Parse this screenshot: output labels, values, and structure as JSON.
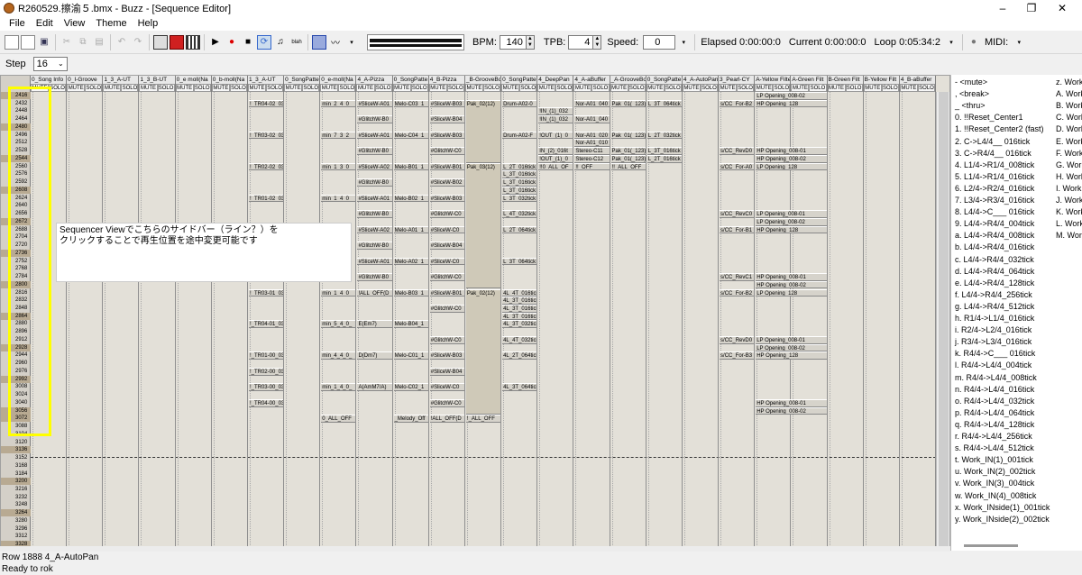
{
  "window": {
    "title": "R260529.擦渝５.bmx - Buzz - [Sequence Editor]"
  },
  "menu": [
    "File",
    "Edit",
    "View",
    "Theme",
    "Help"
  ],
  "toolbar": {
    "bpm_label": "BPM:",
    "bpm": "140",
    "tpb_label": "TPB:",
    "tpb": "4",
    "speed_label": "Speed:",
    "speed": "0",
    "elapsed": "Elapsed 0:00:00:0",
    "current": "Current 0:00:00:0",
    "loop": "Loop 0:05:34:2",
    "midi_label": "MIDI:"
  },
  "step": {
    "label": "Step",
    "value": "16"
  },
  "columns": [
    "0_Song Info",
    "0_I-Groove",
    "1_3_A-UT",
    "1_3_B-UT",
    "0_e moll(Na",
    "0_b-moll(Na",
    "1_3_A-UT",
    "0_SongPatte",
    "0_e-moll(Na",
    "4_A-Pizza",
    "0_SongPatte",
    "4_B-Pizza",
    "_B-GrooveBo",
    "0_SongPatte",
    "4_DeepPan",
    "4_A-aBuffer",
    "_A-GrooveBo",
    "0_SongPatte",
    "4_A-AutoPan",
    "3_Pearl-CY",
    "A-Yellow Filte",
    "A-Green Filt",
    "B-Green Filt",
    "B-Yellow Filt",
    "4_B-aBuffer"
  ],
  "mute_label": "MUTE",
  "solo_label": "SOLO",
  "rows": [
    "2416",
    "2432",
    "2448",
    "2464",
    "2480",
    "2496",
    "2512",
    "2528",
    "2544",
    "2560",
    "2576",
    "2592",
    "2608",
    "2624",
    "2640",
    "2656",
    "2672",
    "2688",
    "2704",
    "2720",
    "2736",
    "2752",
    "2768",
    "2784",
    "2800",
    "2816",
    "2832",
    "2848",
    "2864",
    "2880",
    "2896",
    "2912",
    "2928",
    "2944",
    "2960",
    "2976",
    "2992",
    "3008",
    "3024",
    "3040",
    "3056",
    "3072",
    "3088",
    "3104",
    "3120",
    "3136",
    "3152",
    "3168",
    "3184",
    "3200",
    "3216",
    "3232",
    "3248",
    "3264",
    "3280",
    "3296",
    "3312",
    "3328"
  ],
  "patterns": [
    {
      "col": 6,
      "row": 1,
      "len": 1,
      "text": "!_TR04-02_032"
    },
    {
      "col": 6,
      "row": 5,
      "len": 1,
      "text": "!_TR03-02_032"
    },
    {
      "col": 6,
      "row": 9,
      "len": 1,
      "text": "!_TR02-02_032"
    },
    {
      "col": 6,
      "row": 13,
      "len": 1,
      "text": "!_TR01-02_032"
    },
    {
      "col": 6,
      "row": 25,
      "len": 1,
      "text": "!_TR03-01_032"
    },
    {
      "col": 6,
      "row": 29,
      "len": 1,
      "text": "!_TR04-01_032"
    },
    {
      "col": 6,
      "row": 33,
      "len": 1,
      "text": "!_TR01-00_032"
    },
    {
      "col": 6,
      "row": 35,
      "len": 1,
      "text": "!_TR02-00_032"
    },
    {
      "col": 6,
      "row": 37,
      "len": 1,
      "text": "!_TR03-00_032"
    },
    {
      "col": 6,
      "row": 39,
      "len": 1,
      "text": "!_TR04-00_032"
    },
    {
      "col": 8,
      "row": 1,
      "len": 1,
      "text": "min_2_4_0_"
    },
    {
      "col": 8,
      "row": 5,
      "len": 1,
      "text": "min_7_3_2_"
    },
    {
      "col": 8,
      "row": 9,
      "len": 1,
      "text": "min_1_3_0_"
    },
    {
      "col": 8,
      "row": 13,
      "len": 1,
      "text": "min_1_4_0_"
    },
    {
      "col": 8,
      "row": 25,
      "len": 1,
      "text": "min_1_4_0_"
    },
    {
      "col": 8,
      "row": 29,
      "len": 1,
      "text": "min_5_4_0_"
    },
    {
      "col": 8,
      "row": 33,
      "len": 1,
      "text": "min_4_4_0_"
    },
    {
      "col": 8,
      "row": 37,
      "len": 1,
      "text": "min_1_4_0_"
    },
    {
      "col": 8,
      "row": 41,
      "len": 1,
      "text": "0_ALL_OFF"
    },
    {
      "col": 9,
      "row": 1,
      "len": 1,
      "text": "#SliceW-A01"
    },
    {
      "col": 9,
      "row": 3,
      "len": 1,
      "text": "#GlitchW-B0"
    },
    {
      "col": 9,
      "row": 5,
      "len": 1,
      "text": "#SliceW-A01"
    },
    {
      "col": 9,
      "row": 7,
      "len": 1,
      "text": "#GlitchW-B0"
    },
    {
      "col": 9,
      "row": 9,
      "len": 1,
      "text": "#SliceW-A02"
    },
    {
      "col": 9,
      "row": 11,
      "len": 1,
      "text": "#GlitchW-B0"
    },
    {
      "col": 9,
      "row": 13,
      "len": 1,
      "text": "#SliceW-A01"
    },
    {
      "col": 9,
      "row": 15,
      "len": 1,
      "text": "#GlitchW-B0"
    },
    {
      "col": 9,
      "row": 17,
      "len": 1,
      "text": "#SliceW-A02"
    },
    {
      "col": 9,
      "row": 19,
      "len": 1,
      "text": "#GlitchW-B0"
    },
    {
      "col": 9,
      "row": 21,
      "len": 1,
      "text": "#SliceW-A01"
    },
    {
      "col": 9,
      "row": 23,
      "len": 1,
      "text": "#GlitchW-B0"
    },
    {
      "col": 9,
      "row": 25,
      "len": 1,
      "text": "!ALL_OFF(D"
    },
    {
      "col": 9,
      "row": 29,
      "len": 1,
      "text": "E(Em7)"
    },
    {
      "col": 9,
      "row": 33,
      "len": 1,
      "text": "D(Dm7)"
    },
    {
      "col": 9,
      "row": 37,
      "len": 1,
      "text": "A(AmM7/A)"
    },
    {
      "col": 10,
      "row": 1,
      "len": 1,
      "text": "Melo-C03_1"
    },
    {
      "col": 10,
      "row": 5,
      "len": 1,
      "text": "Melo-C04_1"
    },
    {
      "col": 10,
      "row": 9,
      "len": 1,
      "text": "Melo-B01_1"
    },
    {
      "col": 10,
      "row": 13,
      "len": 1,
      "text": "Melo-B02_1"
    },
    {
      "col": 10,
      "row": 17,
      "len": 1,
      "text": "Melo-A01_1"
    },
    {
      "col": 10,
      "row": 21,
      "len": 1,
      "text": "Melo-A02_1"
    },
    {
      "col": 10,
      "row": 25,
      "len": 1,
      "text": "Melo-B03_1"
    },
    {
      "col": 10,
      "row": 29,
      "len": 1,
      "text": "Melo-B04_1"
    },
    {
      "col": 10,
      "row": 33,
      "len": 1,
      "text": "Melo-C01_1"
    },
    {
      "col": 10,
      "row": 37,
      "len": 1,
      "text": "Melo-C02_1"
    },
    {
      "col": 10,
      "row": 41,
      "len": 1,
      "text": "_Melody_Off"
    },
    {
      "col": 11,
      "row": 1,
      "len": 1,
      "text": "#SliceW-B03"
    },
    {
      "col": 11,
      "row": 3,
      "len": 1,
      "text": "#SliceW-B04"
    },
    {
      "col": 11,
      "row": 5,
      "len": 1,
      "text": "#SliceW-B03"
    },
    {
      "col": 11,
      "row": 7,
      "len": 1,
      "text": "#GlitchW-C0"
    },
    {
      "col": 11,
      "row": 9,
      "len": 1,
      "text": "#SliceW-B01"
    },
    {
      "col": 11,
      "row": 11,
      "len": 1,
      "text": "#SliceW-B02"
    },
    {
      "col": 11,
      "row": 13,
      "len": 1,
      "text": "#SliceW-B03"
    },
    {
      "col": 11,
      "row": 15,
      "len": 1,
      "text": "#GlitchW-C0"
    },
    {
      "col": 11,
      "row": 17,
      "len": 1,
      "text": "#SliceW-C0"
    },
    {
      "col": 11,
      "row": 19,
      "len": 1,
      "text": "#SliceW-B04"
    },
    {
      "col": 11,
      "row": 21,
      "len": 1,
      "text": "#SliceW-C0"
    },
    {
      "col": 11,
      "row": 23,
      "len": 1,
      "text": "#GlitchW-C0"
    },
    {
      "col": 11,
      "row": 25,
      "len": 1,
      "text": "#SliceW-B01"
    },
    {
      "col": 11,
      "row": 27,
      "len": 1,
      "text": "#GlitchW-C0"
    },
    {
      "col": 11,
      "row": 31,
      "len": 1,
      "text": "#GlitchW-C0"
    },
    {
      "col": 11,
      "row": 33,
      "len": 1,
      "text": "#SliceW-B03"
    },
    {
      "col": 11,
      "row": 35,
      "len": 1,
      "text": "#SliceW-B04"
    },
    {
      "col": 11,
      "row": 37,
      "len": 1,
      "text": "#SliceW-C0"
    },
    {
      "col": 11,
      "row": 39,
      "len": 1,
      "text": "#GlitchW-C0"
    },
    {
      "col": 11,
      "row": 41,
      "len": 1,
      "text": "!ALL_OFF(D"
    },
    {
      "col": 12,
      "row": 1,
      "len": 8,
      "text": "Pak_02(12)"
    },
    {
      "col": 12,
      "row": 9,
      "len": 16,
      "text": "Pak_03(12)"
    },
    {
      "col": 12,
      "row": 25,
      "len": 16,
      "text": "Pak_02(12)"
    },
    {
      "col": 12,
      "row": 41,
      "len": 1,
      "text": "!_ALL_OFF"
    },
    {
      "col": 13,
      "row": 1,
      "len": 1,
      "text": "Drum-A02-0"
    },
    {
      "col": 13,
      "row": 5,
      "len": 1,
      "text": "Drum-A02-F"
    },
    {
      "col": 13,
      "row": 9,
      "len": 1,
      "text": "L_2T_016tick"
    },
    {
      "col": 13,
      "row": 10,
      "len": 1,
      "text": "L_3T_016tick"
    },
    {
      "col": 13,
      "row": 11,
      "len": 1,
      "text": "L_3T_016tick"
    },
    {
      "col": 13,
      "row": 12,
      "len": 1,
      "text": "L_3T_016tick"
    },
    {
      "col": 13,
      "row": 13,
      "len": 1,
      "text": "L_3T_032tick"
    },
    {
      "col": 13,
      "row": 15,
      "len": 1,
      "text": "L_4T_032tick"
    },
    {
      "col": 13,
      "row": 17,
      "len": 1,
      "text": "L_2T_064tick"
    },
    {
      "col": 13,
      "row": 21,
      "len": 1,
      "text": "L_3T_064tick"
    },
    {
      "col": 13,
      "row": 25,
      "len": 1,
      "text": "4L_4T_016tick"
    },
    {
      "col": 13,
      "row": 26,
      "len": 1,
      "text": "4L_3T_016tick"
    },
    {
      "col": 13,
      "row": 27,
      "len": 1,
      "text": "4L_3T_016tick"
    },
    {
      "col": 13,
      "row": 28,
      "len": 1,
      "text": "4L_3T_016tick"
    },
    {
      "col": 13,
      "row": 29,
      "len": 1,
      "text": "4L_3T_032tick"
    },
    {
      "col": 13,
      "row": 31,
      "len": 1,
      "text": "4L_4T_032tick"
    },
    {
      "col": 13,
      "row": 33,
      "len": 1,
      "text": "4L_2T_064tick"
    },
    {
      "col": 13,
      "row": 37,
      "len": 1,
      "text": "4L_3T_064tick"
    },
    {
      "col": 14,
      "row": 2,
      "len": 1,
      "text": "!IN_(1)_032"
    },
    {
      "col": 14,
      "row": 3,
      "len": 1,
      "text": "!IN_(1)_032"
    },
    {
      "col": 14,
      "row": 5,
      "len": 1,
      "text": "!OUT_(1)_0"
    },
    {
      "col": 14,
      "row": 7,
      "len": 1,
      "text": "IN_(2)_016t"
    },
    {
      "col": 14,
      "row": 8,
      "len": 1,
      "text": "!OUT_(1)_0"
    },
    {
      "col": 14,
      "row": 9,
      "len": 1,
      "text": "!!0_ALL_OF"
    },
    {
      "col": 15,
      "row": 1,
      "len": 1,
      "text": "Nor-A01_040"
    },
    {
      "col": 15,
      "row": 3,
      "len": 1,
      "text": "Nor-A01_040"
    },
    {
      "col": 15,
      "row": 5,
      "len": 1,
      "text": "Nor-A01_020"
    },
    {
      "col": 15,
      "row": 6,
      "len": 1,
      "text": "Nor-A01_010"
    },
    {
      "col": 15,
      "row": 7,
      "len": 1,
      "text": "Stereo-C11"
    },
    {
      "col": 15,
      "row": 8,
      "len": 1,
      "text": "Stereo-C12"
    },
    {
      "col": 15,
      "row": 9,
      "len": 1,
      "text": "!!_OFF"
    },
    {
      "col": 16,
      "row": 1,
      "len": 1,
      "text": "Pak_01(_123)"
    },
    {
      "col": 16,
      "row": 5,
      "len": 1,
      "text": "Pak_01(_123)"
    },
    {
      "col": 16,
      "row": 7,
      "len": 1,
      "text": "Pak_01(_123)"
    },
    {
      "col": 16,
      "row": 8,
      "len": 1,
      "text": "Pak_01(_123)"
    },
    {
      "col": 16,
      "row": 9,
      "len": 1,
      "text": "!!_ALL_OFF"
    },
    {
      "col": 17,
      "row": 1,
      "len": 1,
      "text": "L_3T_064tick"
    },
    {
      "col": 17,
      "row": 5,
      "len": 1,
      "text": "L_2T_032tick"
    },
    {
      "col": 17,
      "row": 7,
      "len": 1,
      "text": "L_3T_016tick"
    },
    {
      "col": 17,
      "row": 8,
      "len": 1,
      "text": "L_2T_016tick"
    },
    {
      "col": 19,
      "row": 1,
      "len": 1,
      "text": "s/CC_For-B2"
    },
    {
      "col": 19,
      "row": 7,
      "len": 1,
      "text": "s/CC_RevD0"
    },
    {
      "col": 19,
      "row": 9,
      "len": 1,
      "text": "s/CC_For-A0"
    },
    {
      "col": 19,
      "row": 15,
      "len": 1,
      "text": "s/CC_RevC0"
    },
    {
      "col": 19,
      "row": 17,
      "len": 1,
      "text": "s/CC_For-B1"
    },
    {
      "col": 19,
      "row": 23,
      "len": 1,
      "text": "s/CC_RevC1"
    },
    {
      "col": 19,
      "row": 25,
      "len": 1,
      "text": "s/CC_For-B2"
    },
    {
      "col": 19,
      "row": 31,
      "len": 1,
      "text": "s/CC_RevD0"
    },
    {
      "col": 19,
      "row": 33,
      "len": 1,
      "text": "s/CC_For-B3"
    },
    {
      "col": 20,
      "row": 0,
      "len": 1,
      "text": "LP Opening_008-02"
    },
    {
      "col": 20,
      "row": 1,
      "len": 1,
      "text": "HP Opening_128"
    },
    {
      "col": 20,
      "row": 7,
      "len": 1,
      "text": "HP Opening_008-01"
    },
    {
      "col": 20,
      "row": 8,
      "len": 1,
      "text": "HP Opening_008-02"
    },
    {
      "col": 20,
      "row": 9,
      "len": 1,
      "text": "LP Opening_128"
    },
    {
      "col": 20,
      "row": 15,
      "len": 1,
      "text": "LP Opening_008-01"
    },
    {
      "col": 20,
      "row": 16,
      "len": 1,
      "text": "LP Opening_008-02"
    },
    {
      "col": 20,
      "row": 17,
      "len": 1,
      "text": "HP Opening_128"
    },
    {
      "col": 20,
      "row": 23,
      "len": 1,
      "text": "HP Opening_008-01"
    },
    {
      "col": 20,
      "row": 24,
      "len": 1,
      "text": "HP Opening_008-02"
    },
    {
      "col": 20,
      "row": 25,
      "len": 1,
      "text": "LP Opening_128"
    },
    {
      "col": 20,
      "row": 31,
      "len": 1,
      "text": "LP Opening_008-01"
    },
    {
      "col": 20,
      "row": 32,
      "len": 1,
      "text": "LP Opening_008-02"
    },
    {
      "col": 20,
      "row": 33,
      "len": 1,
      "text": "HP Opening_128"
    },
    {
      "col": 20,
      "row": 39,
      "len": 1,
      "text": "HP Opening_008-01"
    },
    {
      "col": 20,
      "row": 40,
      "len": 1,
      "text": "HP Opening_008-02"
    }
  ],
  "annotation": "Sequencer Viewでこちらのサイドバー（ライン？）を\nクリックすることで再生位置を途中変更可能です",
  "wave_list": [
    "-  <mute>",
    ",  <break>",
    "_  <thru>",
    "0. !!Reset_Center1",
    "1. !!Reset_Center2 (fast)",
    "2. C->L4/4__ 016tick",
    "3. C->R4/4__ 016tick",
    "4. L1/4->R1/4_008tick",
    "5. L1/4->R1/4_016tick",
    "6. L2/4->R2/4_016tick",
    "7. L3/4->R3/4_016tick",
    "8. L4/4->C___ 016tick",
    "9. L4/4->R4/4_004tick",
    "a. L4/4->R4/4_008tick",
    "b. L4/4->R4/4_016tick",
    "c. L4/4->R4/4_032tick",
    "d. L4/4->R4/4_064tick",
    "e. L4/4->R4/4_128tick",
    "f. L4/4->R4/4_256tick",
    "g. L4/4->R4/4_512tick",
    "h. R1/4->L1/4_016tick",
    "i. R2/4->L2/4_016tick",
    "j. R3/4->L3/4_016tick",
    "k. R4/4->C___ 016tick",
    "l. R4/4->L4/4_004tick",
    "m. R4/4->L4/4_008tick",
    "n. R4/4->L4/4_016tick",
    "o. R4/4->L4/4_032tick",
    "p. R4/4->L4/4_064tick",
    "q. R4/4->L4/4_128tick",
    "r. R4/4->L4/4_256tick",
    "s. R4/4->L4/4_512tick",
    "t. Work_IN(1)_001tick",
    "u. Work_IN(2)_002tick",
    "v. Work_IN(3)_004tick",
    "w. Work_IN(4)_008tick",
    "x. Work_INside(1)_001tick",
    "y. Work_INside(2)_002tick"
  ],
  "wave_list2": [
    "z. Work",
    "A. Work",
    "B. Work",
    "C. Work",
    "D. Work",
    "E. Work",
    "F. Work",
    "G. Work",
    "H. Work",
    "I. Work",
    "J. Work",
    "K. Work",
    "L. Work",
    "M. Work"
  ],
  "status_row": "Row 1888 4_A-AutoPan",
  "status": "Ready to rok"
}
